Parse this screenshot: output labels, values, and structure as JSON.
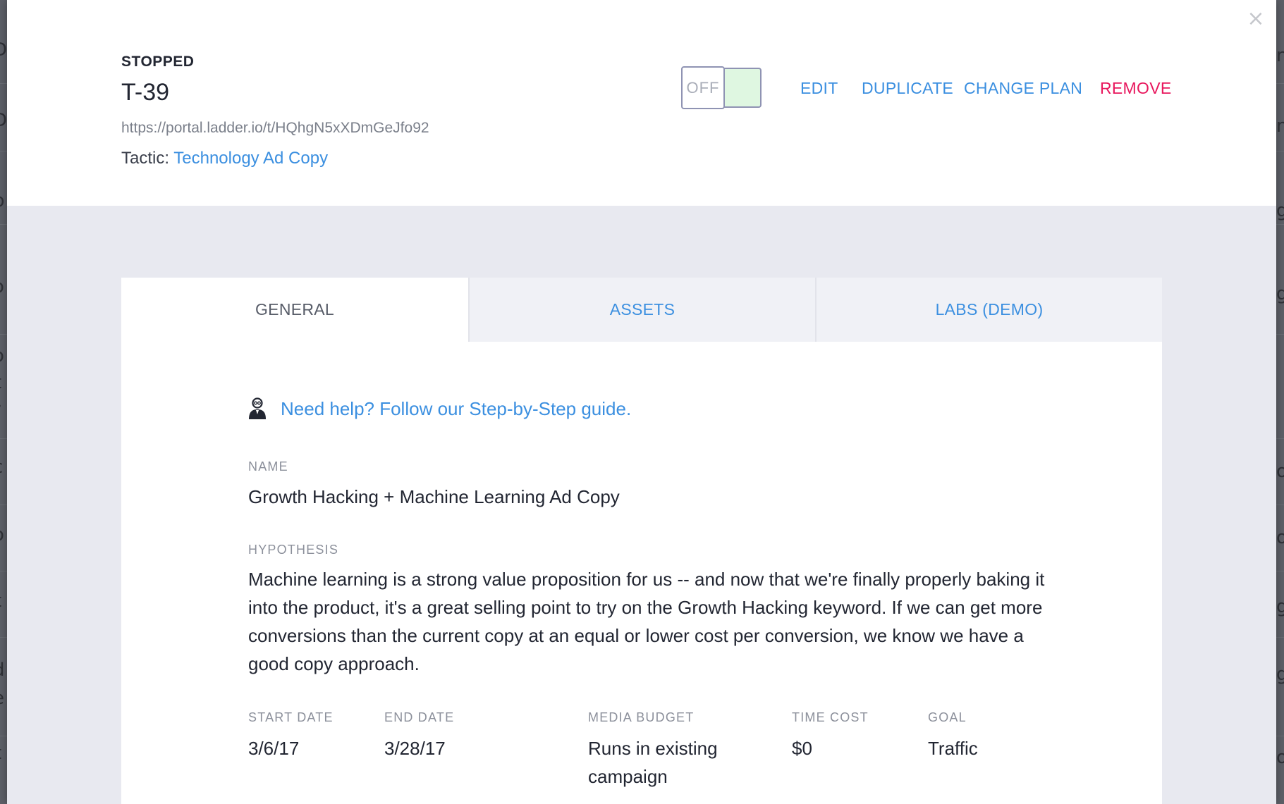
{
  "modal": {
    "close_label": "×",
    "status": "STOPPED",
    "test_id": "T-39",
    "url": "https://portal.ladder.io/t/HQhgN5xXDmGeJfo92",
    "tactic_prefix": "Tactic: ",
    "tactic_name": "Technology Ad Copy",
    "toggle": {
      "label": "OFF",
      "state": "off"
    },
    "actions": {
      "edit": "EDIT",
      "duplicate": "DUPLICATE",
      "change_plan": "CHANGE PLAN",
      "remove": "REMOVE"
    },
    "colors": {
      "accent": "#3b8fe0",
      "danger": "#e8175d",
      "toggle_track": "#dff7e1",
      "page_bg": "#e8e9f0"
    }
  },
  "tabs": [
    {
      "label": "GENERAL",
      "active": true
    },
    {
      "label": "ASSETS",
      "active": false
    },
    {
      "label": "LABS (DEMO)",
      "active": false
    }
  ],
  "general": {
    "help_icon": "user-guide-icon",
    "help_text": "Need help? Follow our Step-by-Step guide.",
    "name_label": "NAME",
    "name_value": "Growth Hacking + Machine Learning Ad Copy",
    "hypothesis_label": "HYPOTHESIS",
    "hypothesis_value": "Machine learning is a strong value proposition for us -- and now that we're finally properly baking it into the product, it's a great selling point to try on the Growth Hacking keyword. If we can get more conversions than the current copy at an equal or lower cost per conversion, we know we have a good copy approach.",
    "fields": {
      "start_date": {
        "label": "START DATE",
        "value": "3/6/17"
      },
      "end_date": {
        "label": "END DATE",
        "value": "3/28/17"
      },
      "media_budget": {
        "label": "MEDIA BUDGET",
        "value": "Runs in existing campaign"
      },
      "time_cost": {
        "label": "TIME COST",
        "value": "$0"
      },
      "goal": {
        "label": "GOAL",
        "value": "Traffic"
      }
    }
  }
}
